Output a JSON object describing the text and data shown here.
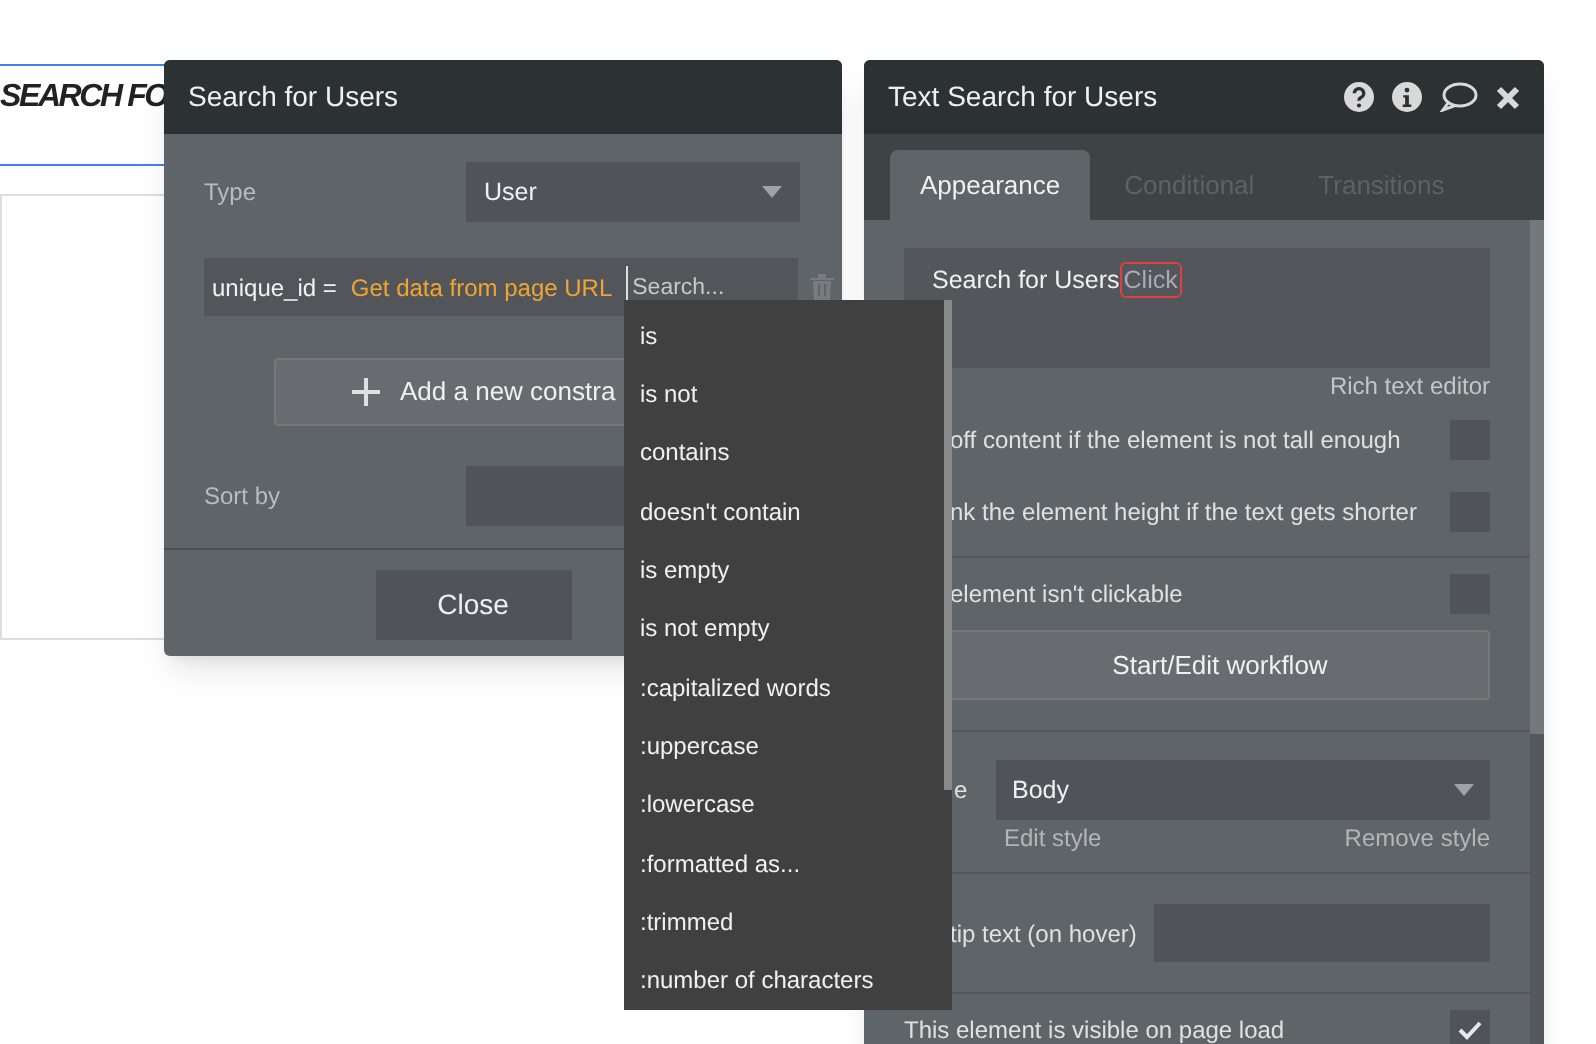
{
  "canvas": {
    "heading_text": "SEARCH FO"
  },
  "search_dialog": {
    "title": "Search for Users",
    "type_label": "Type",
    "type_value": "User",
    "constraint": {
      "field": "unique_id =",
      "source": "Get data from page URL",
      "operator_placeholder": "Search..."
    },
    "add_constraint": "Add a new constra",
    "sort_label": "Sort by",
    "close": "Close"
  },
  "operator_menu": {
    "items": [
      {
        "label": "is"
      },
      {
        "label": "is not"
      },
      {
        "label": "contains"
      },
      {
        "label": "doesn't contain"
      },
      {
        "label": "is empty"
      },
      {
        "label": "is not empty"
      },
      {
        "label": ":capitalized words"
      },
      {
        "label": ":uppercase"
      },
      {
        "label": ":lowercase"
      },
      {
        "label": ":formatted as..."
      },
      {
        "label": ":trimmed"
      },
      {
        "label": ":number of characters"
      }
    ]
  },
  "property_editor": {
    "title": "Text Search for Users",
    "tabs": [
      {
        "label": "Appearance",
        "selected": true
      },
      {
        "label": "Conditional",
        "selected": false
      },
      {
        "label": "Transitions",
        "selected": false
      }
    ],
    "content_text": "Search for Users",
    "dynamic_token": "Click",
    "rich_text_link": "Rich text editor",
    "options": [
      {
        "label": "off content if the element is not tall enough",
        "checked": false
      },
      {
        "label": "nk the element height if the text gets shorter",
        "checked": false
      }
    ],
    "clickable_option": {
      "label": "element isn't clickable",
      "checked": false
    },
    "workflow_button": "Start/Edit workflow",
    "style": {
      "label": "e",
      "value": "Body",
      "edit": "Edit style",
      "remove": "Remove style"
    },
    "tooltip_label": "tip text (on hover)",
    "visible_option": {
      "label": "This element is visible on page load",
      "checked": true
    }
  }
}
